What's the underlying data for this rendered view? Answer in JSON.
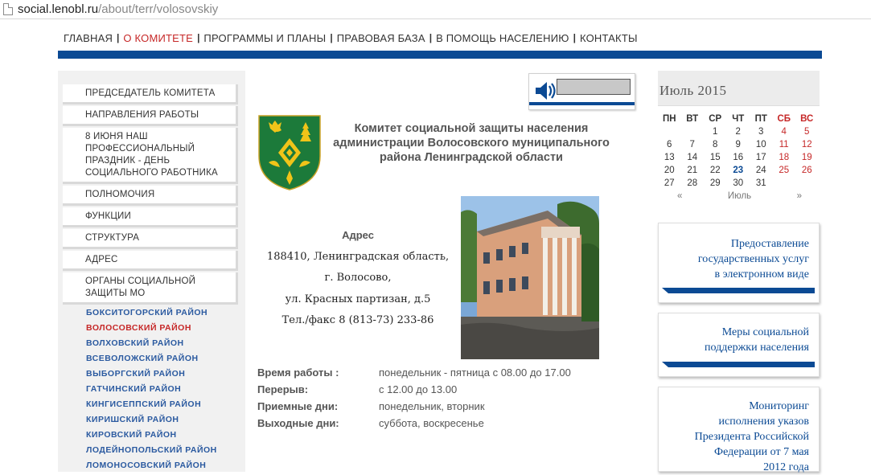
{
  "browser": {
    "url_host": "social.lenobl.ru",
    "url_path": "/about/terr/volosovskiy"
  },
  "top_menu": [
    {
      "label": "ГЛАВНАЯ",
      "active": false
    },
    {
      "label": "О КОМИТЕТЕ",
      "active": true
    },
    {
      "label": "ПРОГРАММЫ И ПЛАНЫ",
      "active": false
    },
    {
      "label": "ПРАВОВАЯ БАЗА",
      "active": false
    },
    {
      "label": "В ПОМОЩЬ НАСЕЛЕНИЮ",
      "active": false
    },
    {
      "label": "КОНТАКТЫ",
      "active": false
    }
  ],
  "left_menu": [
    "ПРЕДСЕДАТЕЛЬ КОМИТЕТА",
    "НАПРАВЛЕНИЯ РАБОТЫ",
    "8 ИЮНЯ НАШ ПРОФЕССИОНАЛЬНЫЙ ПРАЗДНИК - ДЕНЬ СОЦИАЛЬНОГО РАБОТНИКА",
    "ПОЛНОМОЧИЯ",
    "ФУНКЦИИ",
    "СТРУКТУРА",
    "АДРЕС",
    "ОРГАНЫ СОЦИАЛЬНОЙ ЗАЩИТЫ МО"
  ],
  "districts": [
    {
      "label": "БОКСИТОГОРСКИЙ РАЙОН",
      "active": false
    },
    {
      "label": "ВОЛОСОВСКИЙ РАЙОН",
      "active": true
    },
    {
      "label": "ВОЛХОВСКИЙ РАЙОН",
      "active": false
    },
    {
      "label": "ВСЕВОЛОЖСКИЙ РАЙОН",
      "active": false
    },
    {
      "label": "ВЫБОРГСКИЙ РАЙОН",
      "active": false
    },
    {
      "label": "ГАТЧИНСКИЙ РАЙОН",
      "active": false
    },
    {
      "label": "КИНГИСЕППСКИЙ РАЙОН",
      "active": false
    },
    {
      "label": "КИРИШСКИЙ РАЙОН",
      "active": false
    },
    {
      "label": "КИРОВСКИЙ РАЙОН",
      "active": false
    },
    {
      "label": "ЛОДЕЙНОПОЛЬСКИЙ РАЙОН",
      "active": false
    },
    {
      "label": "ЛОМОНОСОВСКИЙ РАЙОН",
      "active": false
    }
  ],
  "org": {
    "title": "Комитет социальной защиты населения администрации Волосовского муниципального района Ленинградской области"
  },
  "address": {
    "heading": "Адрес",
    "lines": [
      "188410, Ленинградская область,",
      "г. Волосово,",
      "ул. Красных партизан, д.5",
      "Тел./факс 8 (813-73) 233-86"
    ]
  },
  "schedule": [
    {
      "label": "Время работы :",
      "value": "понедельник - пятница с 08.00 до 17.00"
    },
    {
      "label": "Перерыв:",
      "value": "с 12.00 до 13.00"
    },
    {
      "label": "Приемные дни:",
      "value": "понедельник, вторник"
    },
    {
      "label": "Выходные дни:",
      "value": "суббота, воскресенье"
    }
  ],
  "calendar": {
    "title": "Июль 2015",
    "weekdays": [
      "ПН",
      "ВТ",
      "СР",
      "ЧТ",
      "ПТ",
      "СБ",
      "ВС"
    ],
    "weeks": [
      [
        "",
        "",
        "1",
        "2",
        "3",
        "4",
        "5"
      ],
      [
        "6",
        "7",
        "8",
        "9",
        "10",
        "11",
        "12"
      ],
      [
        "13",
        "14",
        "15",
        "16",
        "17",
        "18",
        "19"
      ],
      [
        "20",
        "21",
        "22",
        "23",
        "24",
        "25",
        "26"
      ],
      [
        "27",
        "28",
        "29",
        "30",
        "31",
        "",
        ""
      ]
    ],
    "today": "23",
    "prev": "«",
    "month_label": "Июль",
    "next": "»"
  },
  "promos": [
    {
      "lines": [
        "Предоставление",
        "государственных услуг",
        "в электронном виде"
      ]
    },
    {
      "lines": [
        "Меры социальной",
        "поддержки населения"
      ]
    },
    {
      "lines": [
        "Мониторинг",
        "исполнения указов",
        "Президента Российской",
        "Федерации от 7 мая",
        "2012 года"
      ]
    }
  ],
  "colors": {
    "brand_blue": "#0b4a94",
    "active_red": "#c62828"
  }
}
